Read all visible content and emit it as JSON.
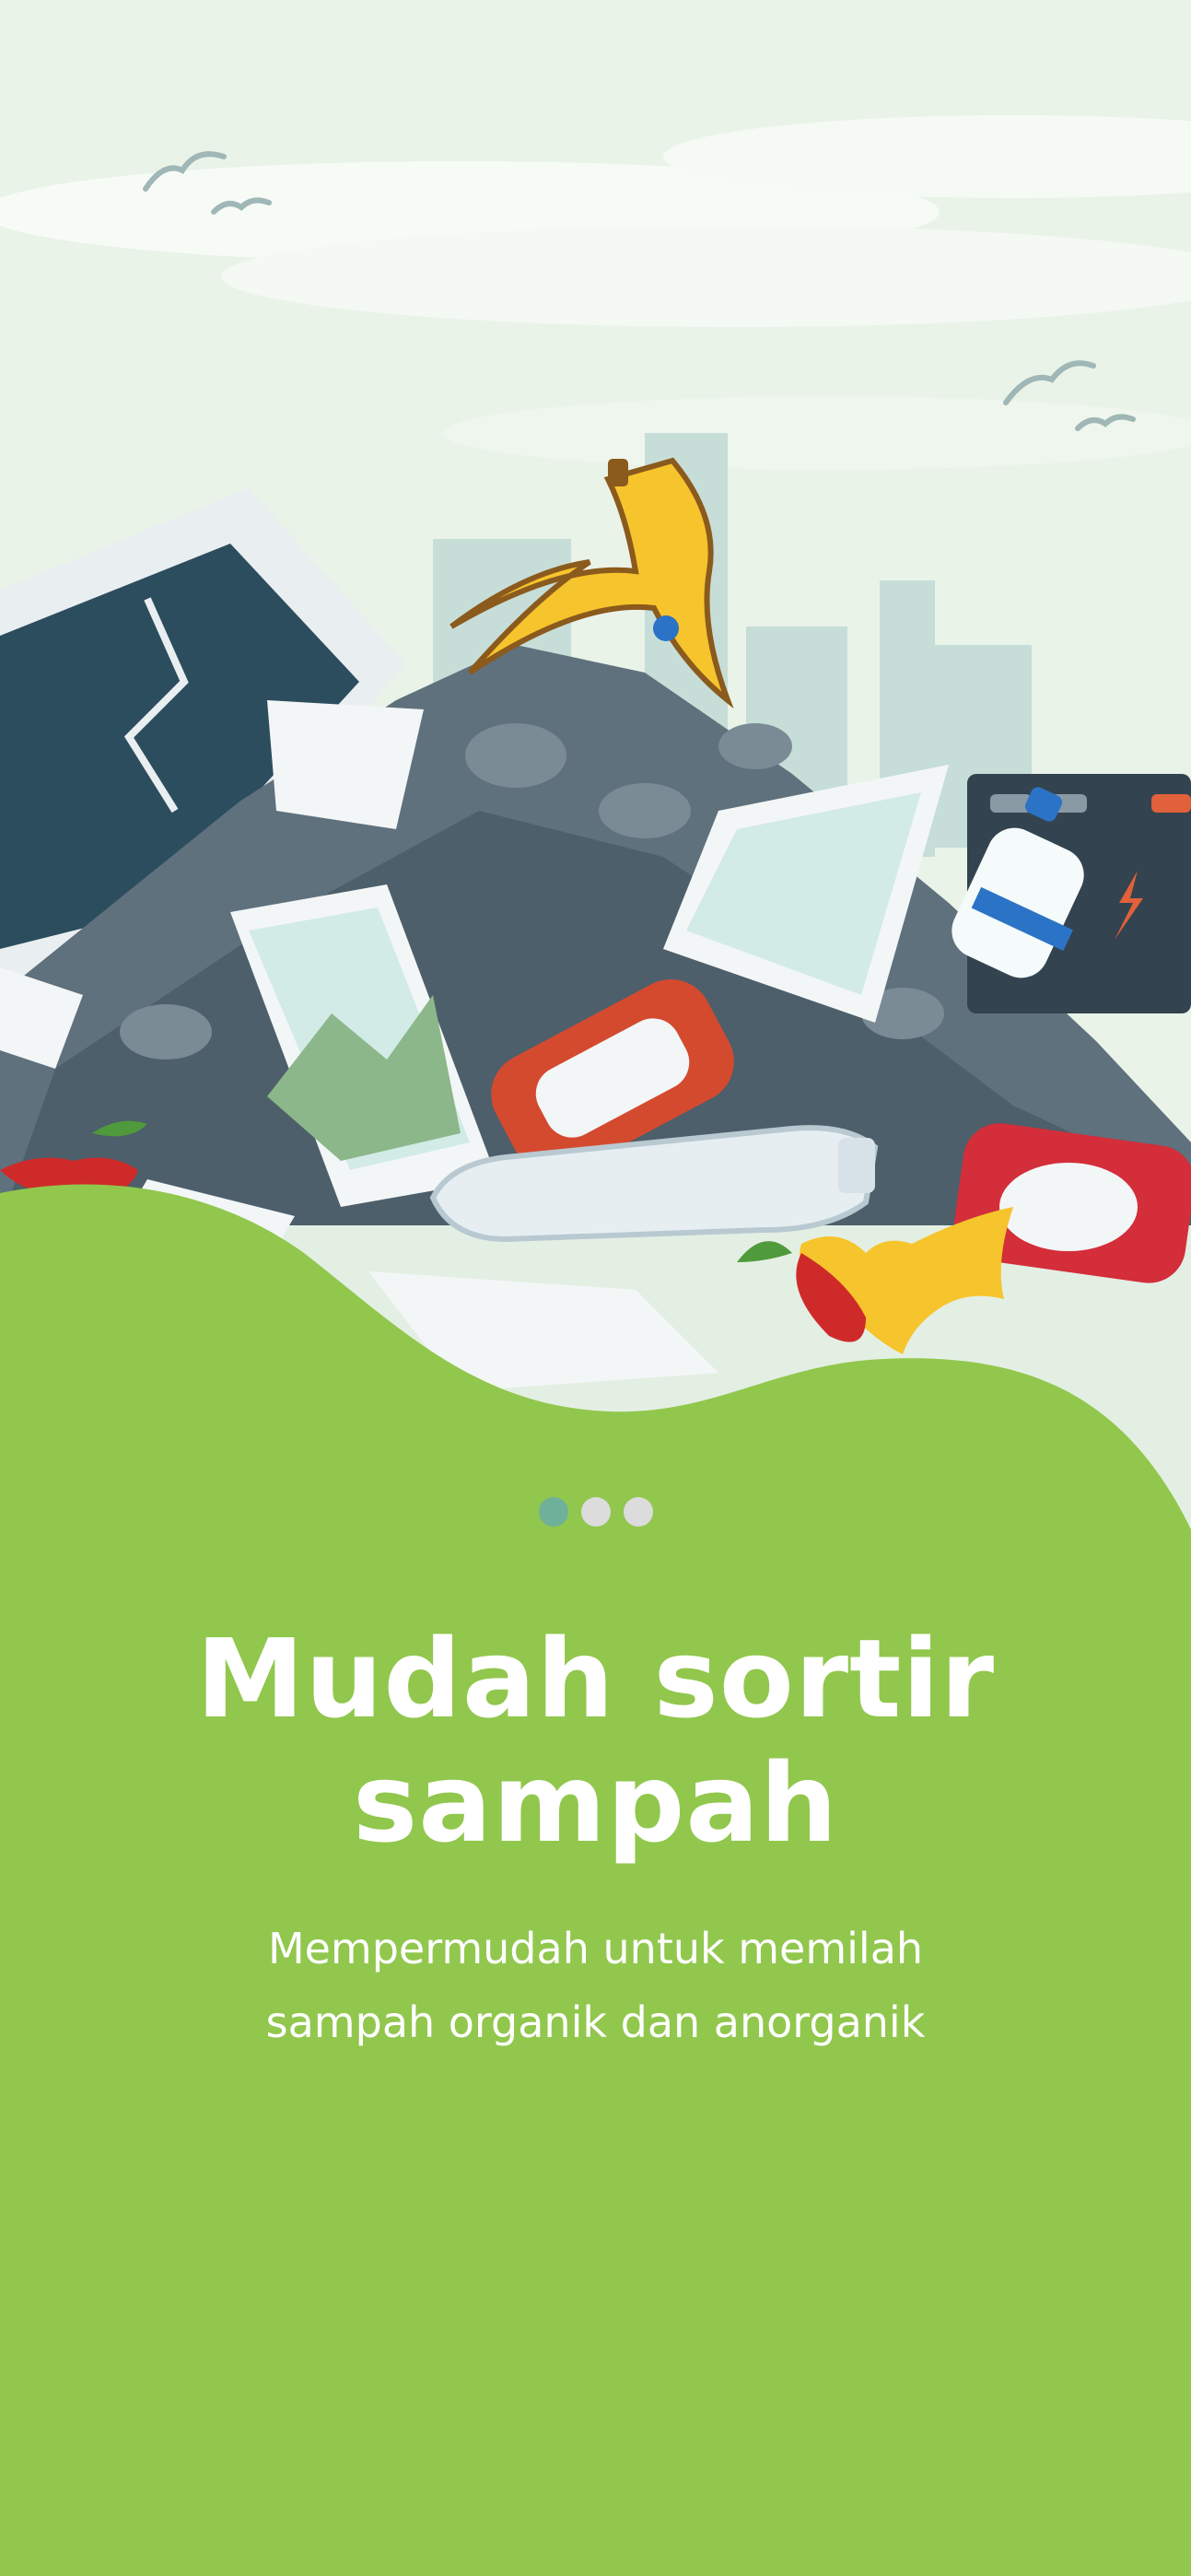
{
  "onboarding": {
    "title": "Mudah sortir sampah",
    "subtitle": "Mempermudah untuk memilah sampah organik dan anorganik",
    "page_indicator": {
      "total": 3,
      "active_index": 0
    },
    "illustration": {
      "subject": "garbage-pile-illustration",
      "icon_names": [
        "banana-peel-icon",
        "soda-can-icon",
        "plastic-bottle-icon",
        "apple-core-icon",
        "paper-sheet-icon",
        "battery-icon",
        "broken-screen-icon",
        "bird-icon"
      ]
    }
  },
  "colors": {
    "primary_green": "#91c74d",
    "sky": "#e9f3e8",
    "indicator_active": "#6fb09a",
    "indicator_inactive": "#dcdcdc",
    "text": "#ffffff"
  }
}
